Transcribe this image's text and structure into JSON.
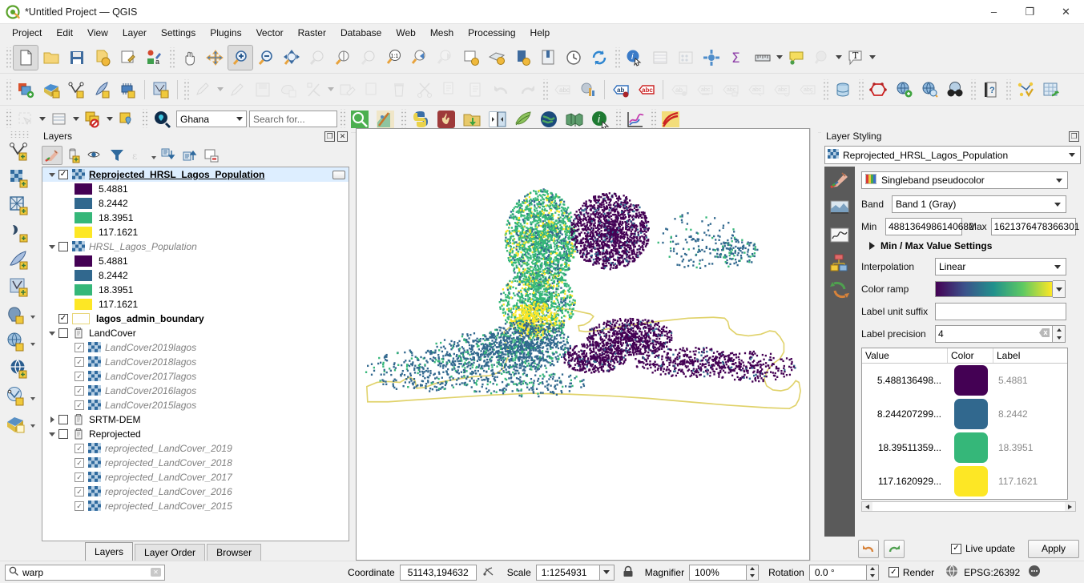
{
  "window": {
    "title": "*Untitled Project — QGIS",
    "minimize": "–",
    "maximize": "❐",
    "close": "✕"
  },
  "menubar": [
    "Project",
    "Edit",
    "View",
    "Layer",
    "Settings",
    "Plugins",
    "Vector",
    "Raster",
    "Database",
    "Web",
    "Mesh",
    "Processing",
    "Help"
  ],
  "toolbar4": {
    "region_combo": "Ghana",
    "search_placeholder": "Search for..."
  },
  "layers_panel": {
    "title": "Layers",
    "tabs": [
      {
        "label": "Layers",
        "active": true
      },
      {
        "label": "Layer Order",
        "active": false
      },
      {
        "label": "Browser",
        "active": false
      }
    ],
    "tree": [
      {
        "indent": 0,
        "expander": "down",
        "checked": true,
        "icon": "raster-icon",
        "label": "Reprojected_HRSL_Lagos_Population",
        "style": "bold-u",
        "selected": true,
        "badge": true
      },
      {
        "indent": 1,
        "swatch": "#440154",
        "label": "5.4881",
        "style": "plain"
      },
      {
        "indent": 1,
        "swatch": "#31688e",
        "label": "8.2442",
        "style": "plain"
      },
      {
        "indent": 1,
        "swatch": "#35b779",
        "label": "18.3951",
        "style": "plain"
      },
      {
        "indent": 1,
        "swatch": "#fde725",
        "label": "117.1621",
        "style": "plain"
      },
      {
        "indent": 0,
        "expander": "down",
        "checked": false,
        "icon": "raster-icon",
        "label": "HRSL_Lagos_Population",
        "style": "ital-gray"
      },
      {
        "indent": 1,
        "swatch": "#440154",
        "label": "5.4881",
        "style": "plain"
      },
      {
        "indent": 1,
        "swatch": "#31688e",
        "label": "8.2442",
        "style": "plain"
      },
      {
        "indent": 1,
        "swatch": "#35b779",
        "label": "18.3951",
        "style": "plain"
      },
      {
        "indent": 1,
        "swatch": "#fde725",
        "label": "117.1621",
        "style": "plain"
      },
      {
        "indent": 0,
        "expander": "none",
        "checked": true,
        "icon": "vector-poly-icon",
        "label": "lagos_admin_boundary",
        "style": "bold"
      },
      {
        "indent": 0,
        "expander": "down",
        "checked": false,
        "icon": "group-icon",
        "label": "LandCover",
        "style": "plain"
      },
      {
        "indent": 1,
        "checkedLight": true,
        "icon": "raster-icon",
        "label": "LandCover2019lagos",
        "style": "ital-gray"
      },
      {
        "indent": 1,
        "checkedLight": true,
        "icon": "raster-icon",
        "label": "LandCover2018lagos",
        "style": "ital-gray"
      },
      {
        "indent": 1,
        "checkedLight": true,
        "icon": "raster-icon",
        "label": "LandCover2017lagos",
        "style": "ital-gray"
      },
      {
        "indent": 1,
        "checkedLight": true,
        "icon": "raster-icon",
        "label": "LandCover2016lagos",
        "style": "ital-gray"
      },
      {
        "indent": 1,
        "checkedLight": true,
        "icon": "raster-icon",
        "label": "LandCover2015lagos",
        "style": "ital-gray"
      },
      {
        "indent": 0,
        "expander": "right",
        "checked": false,
        "icon": "group-icon",
        "label": "SRTM-DEM",
        "style": "plain"
      },
      {
        "indent": 0,
        "expander": "down",
        "checked": false,
        "icon": "group-icon",
        "label": "Reprojected",
        "style": "plain"
      },
      {
        "indent": 1,
        "checkedLight": true,
        "icon": "raster-icon",
        "label": "reprojected_LandCover_2019",
        "style": "ital-gray"
      },
      {
        "indent": 1,
        "checkedLight": true,
        "icon": "raster-icon",
        "label": "reprojected_LandCover_2018",
        "style": "ital-gray"
      },
      {
        "indent": 1,
        "checkedLight": true,
        "icon": "raster-icon",
        "label": "reprojected_LandCover_2017",
        "style": "ital-gray"
      },
      {
        "indent": 1,
        "checkedLight": true,
        "icon": "raster-icon",
        "label": "reprojected_LandCover_2016",
        "style": "ital-gray"
      },
      {
        "indent": 1,
        "checkedLight": true,
        "icon": "raster-icon",
        "label": "reprojected_LandCover_2015",
        "style": "ital-gray"
      }
    ]
  },
  "style_panel": {
    "title": "Layer Styling",
    "layer_combo": "Reprojected_HRSL_Lagos_Population",
    "render_type": "Singleband pseudocolor",
    "band_label": "Band",
    "band_value": "Band 1 (Gray)",
    "min_label": "Min",
    "min_value": "4881364986140682",
    "max_label": "Max",
    "max_value": "1621376478366301",
    "minmax_settings": "Min / Max Value Settings",
    "interpolation_label": "Interpolation",
    "interpolation_value": "Linear",
    "colorramp_label": "Color ramp",
    "colorramp_name": "Viridis",
    "label_unit_suffix_label": "Label unit suffix",
    "label_unit_suffix_value": "",
    "label_precision_label": "Label precision",
    "label_precision_value": "4",
    "table": {
      "headers": [
        "Value",
        "Color",
        "Label"
      ],
      "rows": [
        {
          "value": "5.488136498...",
          "color": "#440154",
          "label": "5.4881"
        },
        {
          "value": "8.244207299...",
          "color": "#31688e",
          "label": "8.2442"
        },
        {
          "value": "18.39511359...",
          "color": "#35b779",
          "label": "18.3951"
        },
        {
          "value": "117.1620929...",
          "color": "#fde725",
          "label": "117.1621"
        }
      ]
    },
    "live_update_label": "Live update",
    "live_update_checked": true,
    "apply_label": "Apply"
  },
  "statusbar": {
    "locator_value": "warp",
    "coordinate_label": "Coordinate",
    "coordinate_value": "51143,194632",
    "scale_label": "Scale",
    "scale_value": "1:1254931",
    "magnifier_label": "Magnifier",
    "magnifier_value": "100%",
    "rotation_label": "Rotation",
    "rotation_value": "0.0 °",
    "render_label": "Render",
    "render_checked": true,
    "crs_label": "EPSG:26392"
  },
  "colors": {
    "accent": "#5ba32b",
    "panel_bg": "#f0f0f0",
    "canvas_bg": "#ffffff",
    "boundary_line": "#e0d26a",
    "selection": "#ddeeff"
  }
}
